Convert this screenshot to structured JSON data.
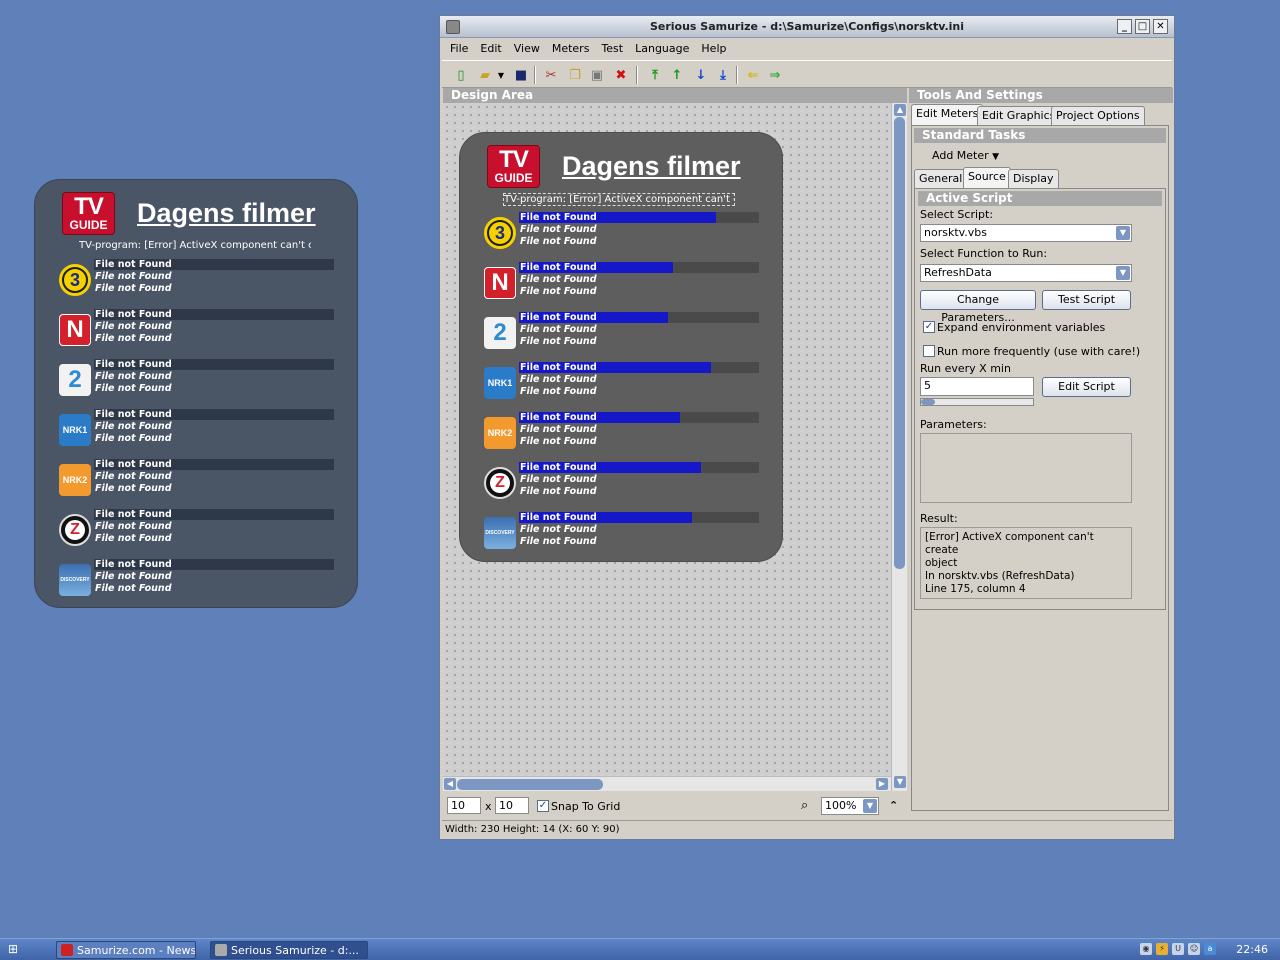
{
  "widget": {
    "logo_tv": "TV",
    "logo_guide": "GUIDE",
    "title": "Dagens filmer",
    "subtitle": "TV-program: [Error] ActiveX component can't create object",
    "channels": [
      {
        "icon": "tv3-icon",
        "label": "3",
        "lines": [
          "File not Found",
          "File not Found",
          "File not Found"
        ],
        "progress_desk": 0,
        "progress_design": 0.82
      },
      {
        "icon": "tvnorge-icon",
        "label": "N",
        "lines": [
          "File not Found",
          "File not Found",
          "File not Found"
        ],
        "progress_desk": 0,
        "progress_design": 0.64
      },
      {
        "icon": "tv2-icon",
        "label": "2",
        "lines": [
          "File not Found",
          "File not Found",
          "File not Found"
        ],
        "progress_desk": 0,
        "progress_design": 0.62
      },
      {
        "icon": "nrk1-icon",
        "label": "NRK1",
        "lines": [
          "File not Found",
          "File not Found",
          "File not Found"
        ],
        "progress_desk": 0,
        "progress_design": 0.8
      },
      {
        "icon": "nrk2-icon",
        "label": "NRK2",
        "lines": [
          "File not Found",
          "File not Found",
          "File not Found"
        ],
        "progress_desk": 0,
        "progress_design": 0.67
      },
      {
        "icon": "zdf-icon",
        "label": "Z",
        "lines": [
          "File not Found",
          "File not Found",
          "File not Found"
        ],
        "progress_desk": 0,
        "progress_design": 0.76
      },
      {
        "icon": "discovery-icon",
        "label": "DISCOVERY",
        "lines": [
          "File not Found",
          "File not Found",
          "File not Found"
        ],
        "progress_desk": 0,
        "progress_design": 0.72
      }
    ]
  },
  "window": {
    "title": "Serious Samurize - d:\\Samurize\\Configs\\norsktv.ini",
    "menu": [
      "File",
      "Edit",
      "View",
      "Meters",
      "Test",
      "Language",
      "Help"
    ],
    "toolbar_icons": [
      "new-icon",
      "open-icon",
      "save-icon",
      "cut-icon",
      "copy-icon",
      "paste-icon",
      "delete-icon",
      "move-top-icon",
      "move-up-icon",
      "move-down-icon",
      "move-bottom-icon",
      "arrow-left-icon",
      "arrow-right-icon"
    ],
    "design_area_label": "Design Area",
    "grid_x": "10",
    "grid_sep": "x",
    "grid_y": "10",
    "snap_label": "Snap To Grid",
    "zoom": "100%",
    "status": "Width: 230  Height: 14  (X: 60  Y: 90)"
  },
  "tools": {
    "header": "Tools And Settings",
    "tabs": [
      "Edit Meters",
      "Edit Graphics",
      "Project Options"
    ],
    "standard_tasks": "Standard Tasks",
    "add_meter": "Add Meter",
    "subtabs": [
      "General",
      "Source",
      "Display"
    ],
    "active_script": "Active Script",
    "select_script_label": "Select Script:",
    "select_script_value": "norsktv.vbs",
    "select_function_label": "Select Function to Run:",
    "select_function_value": "RefreshData",
    "change_params": "Change Parameters...",
    "test_script": "Test Script",
    "expand_env": "Expand environment variables",
    "run_more": "Run more frequently (use with care!)",
    "run_every_label": "Run every X min",
    "run_every_value": "5",
    "edit_script": "Edit Script",
    "parameters_label": "Parameters:",
    "result_label": "Result:",
    "result_lines": [
      "[Error] ActiveX component can't create",
      "object",
      "In norsktv.vbs (RefreshData)",
      "Line 175, column 4"
    ]
  },
  "taskbar": {
    "tasks": [
      "Samurize.com - News...",
      "Serious Samurize - d:..."
    ],
    "clock": "22:46"
  },
  "colors": {
    "desktop": "#5f80b8",
    "progress_fill": "#1418c8",
    "logo_red": "#c8102e"
  }
}
